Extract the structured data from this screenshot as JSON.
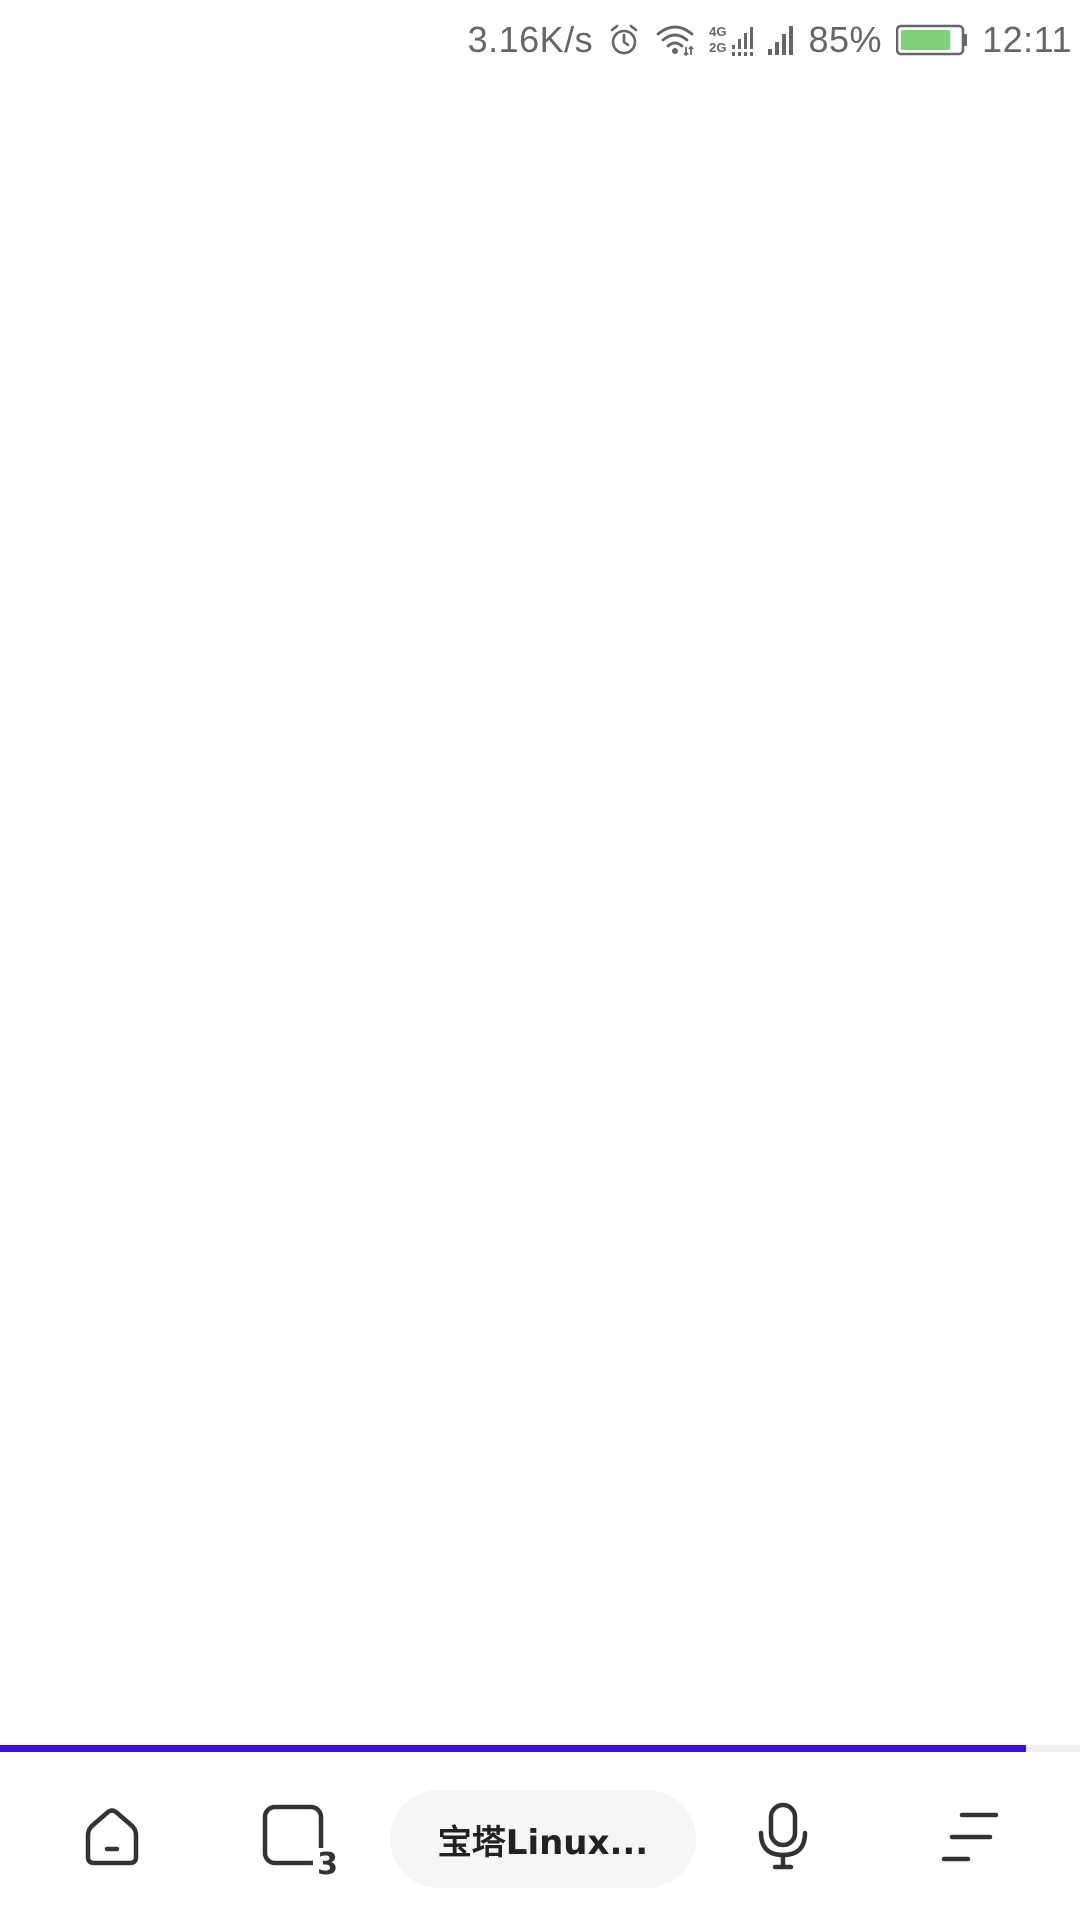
{
  "status_bar": {
    "network_speed": "3.16K/s",
    "network_type_top": "4G",
    "network_type_bottom": "2G",
    "battery_percent": "85%",
    "battery_level": 0.85,
    "battery_color": "#7ed07a",
    "time": "12:11",
    "icons": [
      "alarm-icon",
      "wifi-icon",
      "dual-signal-icon",
      "signal-icon",
      "battery-icon"
    ]
  },
  "page_load": {
    "progress": 0.95,
    "color": "#3b10e0"
  },
  "toolbar": {
    "home_icon": "home-icon",
    "tabs_icon": "tabs-icon",
    "tab_count": "3",
    "address_text": "宝塔Linux...",
    "mic_icon": "microphone-icon",
    "menu_icon": "menu-icon"
  }
}
